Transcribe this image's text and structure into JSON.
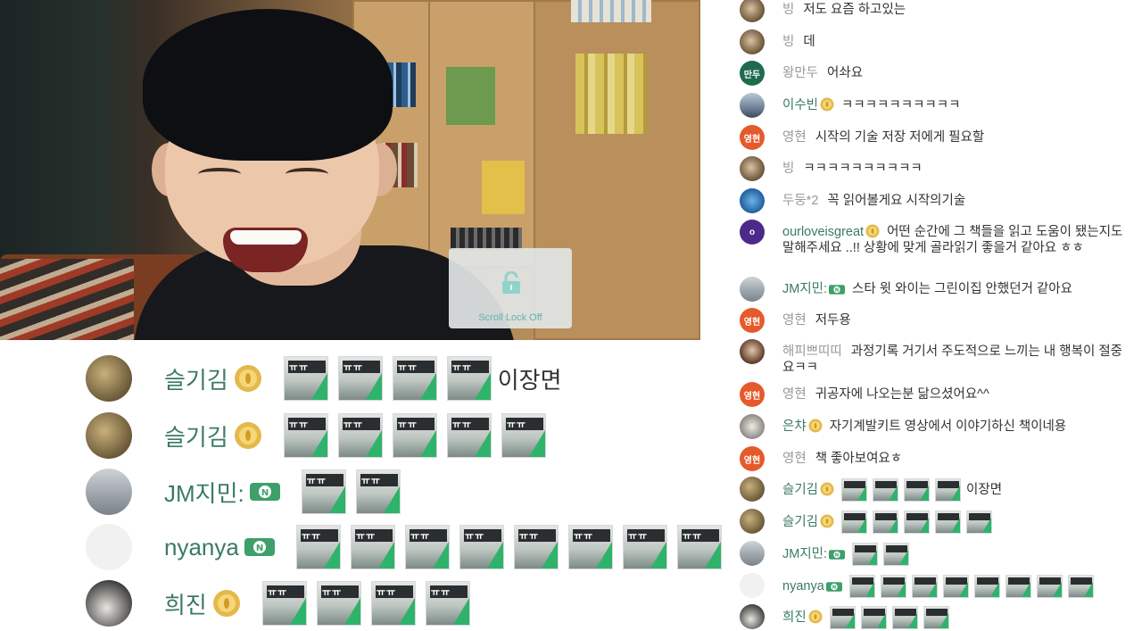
{
  "scroll_lock": {
    "label": "Scroll Lock Off",
    "icon": "unlock-icon"
  },
  "colors": {
    "name_green": "#3a7a64",
    "name_gray": "#999999",
    "gold_badge": "#e5b84a",
    "n_badge": "#3e9f6a",
    "host_avatar": "#e55a2b",
    "scroll_lock_text": "#5fb5ad"
  },
  "emote_label": "ㅠㅠ",
  "overlay": {
    "rows": [
      {
        "name": "슬기김",
        "badge": "gold-coin-badge",
        "emotes": 4,
        "text": "이장면"
      },
      {
        "name": "슬기김",
        "badge": "gold-coin-badge",
        "emotes": 5,
        "text": ""
      },
      {
        "name": "JM지민:",
        "badge": "n-badge",
        "emotes": 2,
        "text": ""
      },
      {
        "name": "nyanya",
        "badge": "n-badge",
        "emotes": 8,
        "text": ""
      },
      {
        "name": "희진",
        "badge": "gold-coin-badge",
        "emotes": 4,
        "text": ""
      }
    ]
  },
  "chat": {
    "host_avatar_label": "영현",
    "mandu_avatar_label": "만두",
    "o_avatar_label": "o",
    "messages": [
      {
        "name": "빙",
        "text": "저도 요즘 하고있는"
      },
      {
        "name": "빙",
        "text": "데"
      },
      {
        "name": "왕만두",
        "text": "어솨요"
      },
      {
        "name": "이수빈",
        "text": "ㅋㅋㅋㅋㅋㅋㅋㅋㅋㅋ"
      },
      {
        "name": "영현",
        "text": "시작의 기술 저장 저에게 필요할"
      },
      {
        "name": "빙",
        "text": "ㅋㅋㅋㅋㅋㅋㅋㅋㅋㅋ"
      },
      {
        "name": "두둥*2",
        "text": "꼭 읽어볼게요 시작의기술"
      },
      {
        "name": "ourloveisgreat",
        "text": "어떤 순간에 그 책들을 읽고 도움이 됐는지도 말해주세요 ..!! 상황에 맞게 골라읽기 좋을거 같아요 ㅎㅎ"
      },
      {
        "name": "JM지민:",
        "text": "스타 윗 와이는 그린이집 안했던거 같아요"
      },
      {
        "name": "영현",
        "text": "저두용"
      },
      {
        "name": "해피쁘띠띠",
        "text": "과정기록 거기서 주도적으로 느끼는 내 행복이 절중요ㅋㅋ"
      },
      {
        "name": "영현",
        "text": "귀공자에 나오는분 닮으셨어요^^"
      },
      {
        "name": "은챠",
        "text": "자기계발키트 영상에서 이야기하신 책이네용"
      },
      {
        "name": "영현",
        "text": "책 좋아보여요ㅎ"
      },
      {
        "name": "슬기김",
        "text": "이장면"
      },
      {
        "name": "슬기김",
        "text": ""
      },
      {
        "name": "JM지민:",
        "text": ""
      },
      {
        "name": "nyanya",
        "text": ""
      },
      {
        "name": "희진",
        "text": ""
      }
    ]
  }
}
